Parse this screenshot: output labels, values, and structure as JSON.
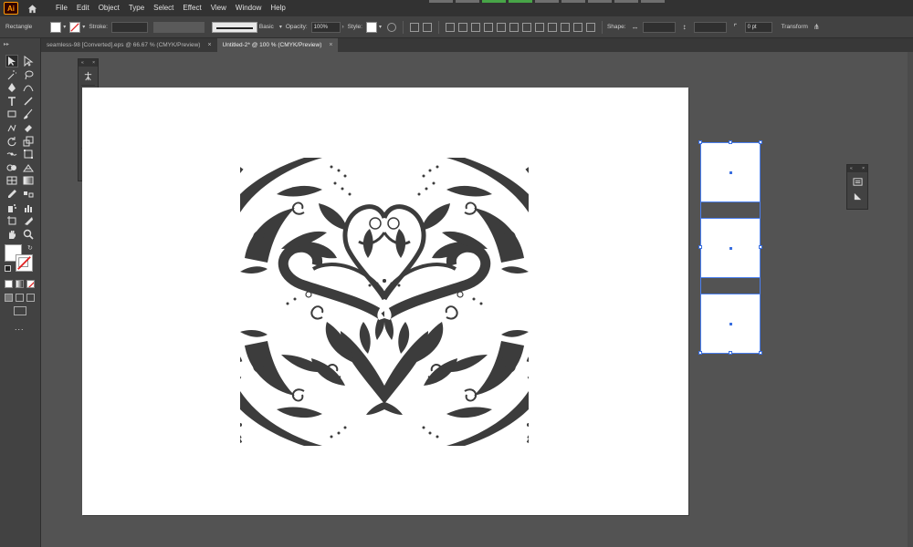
{
  "app": {
    "logo_text": "Ai",
    "menus": [
      "File",
      "Edit",
      "Object",
      "Type",
      "Select",
      "Effect",
      "View",
      "Window",
      "Help"
    ]
  },
  "control_bar": {
    "tool_name": "Rectangle",
    "stroke_label": "Stroke:",
    "brush_label": "Basic",
    "opacity_label": "Opacity:",
    "opacity_value": "100%",
    "style_label": "Style:",
    "shape_label": "Shape:",
    "corner_value": "0 pt",
    "transform_label": "Transform"
  },
  "tabs": [
    {
      "label": "seamless-98 [Converted].eps @ 66.67 % (CMYK/Preview)",
      "active": false
    },
    {
      "label": "Untitled-2* @ 100 % (CMYK/Preview)",
      "active": true
    }
  ],
  "tab_close": "×",
  "tools": [
    "selection-tool",
    "direct-selection-tool",
    "magic-wand-tool",
    "lasso-tool",
    "pen-tool",
    "curvature-tool",
    "type-tool",
    "line-segment-tool",
    "rectangle-tool",
    "paintbrush-tool",
    "shaper-tool",
    "eraser-tool",
    "rotate-tool",
    "scale-tool",
    "width-tool",
    "free-transform-tool",
    "shape-builder-tool",
    "perspective-grid-tool",
    "mesh-tool",
    "gradient-tool",
    "eyedropper-tool",
    "blend-tool",
    "symbol-sprayer-tool",
    "column-graph-tool",
    "artboard-tool",
    "slice-tool",
    "hand-tool",
    "zoom-tool"
  ],
  "more_tools": "...",
  "colors": {
    "workspace": "#535353",
    "panel": "#424242",
    "menubar": "#323232",
    "artboard": "#ffffff",
    "ornament": "#3c3c3c",
    "selection": "#3a6fe0"
  }
}
